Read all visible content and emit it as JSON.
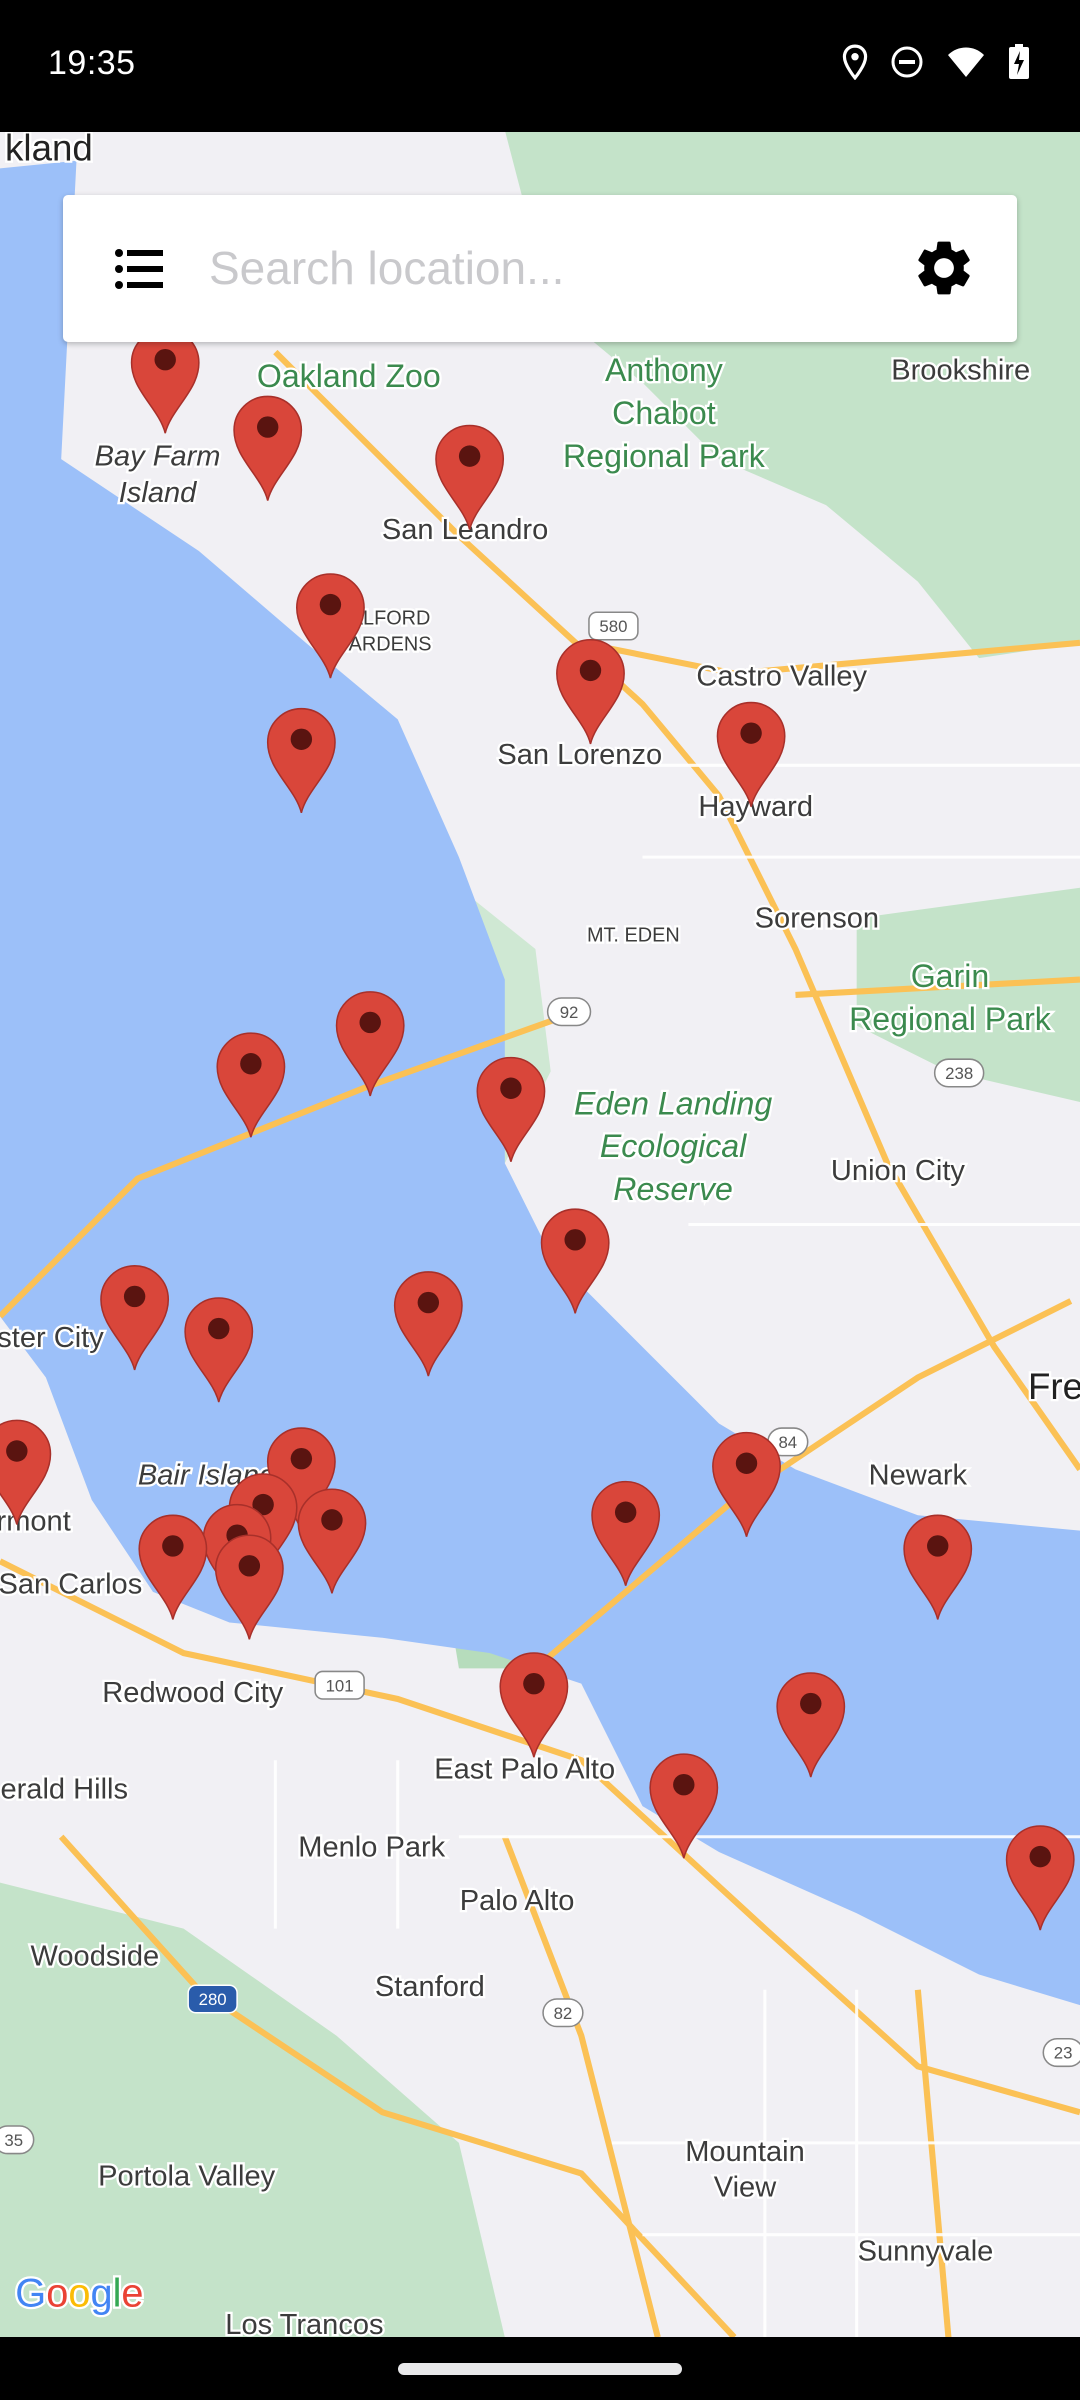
{
  "status_bar": {
    "time": "19:35",
    "icons": [
      "location-icon",
      "do-not-disturb-icon",
      "wifi-icon",
      "battery-charging-icon"
    ]
  },
  "search": {
    "placeholder": "Search location...",
    "value": "",
    "menu_icon": "list-icon",
    "settings_icon": "gear-icon"
  },
  "map": {
    "colors": {
      "water": "#9cc0f9",
      "land": "#f1f0f4",
      "park": "#c4e3c9",
      "road": "#fbc155",
      "marker": "#d9463a"
    },
    "labels": {
      "oakland": "kland",
      "oakland_zoo": "Oakland Zoo",
      "chabot_1": "Anthony",
      "chabot_2": "Chabot",
      "chabot_3": "Regional Park",
      "brookshire": "Brookshire",
      "bay_farm_1": "Bay Farm",
      "bay_farm_2": "Island",
      "san_leandro": "San Leandro",
      "alford_1": "ALFORD",
      "alford_2": "ARDENS",
      "castro_valley": "Castro Valley",
      "san_lorenzo": "San Lorenzo",
      "hayward": "Hayward",
      "sorenson": "Sorenson",
      "mt_eden": "MT. EDEN",
      "garin_1": "Garin",
      "garin_2": "Regional Park",
      "eden_1": "Eden Landing",
      "eden_2": "Ecological",
      "eden_3": "Reserve",
      "union_city": "Union City",
      "foster_city": "ster City",
      "fremont": "Fre",
      "newark": "Newark",
      "bair_island": "Bair Island",
      "belmont": "rmont",
      "san_carlos": "San Carlos",
      "redwood_city": "Redwood City",
      "east_palo_alto": "East Palo Alto",
      "emerald_hills": "erald Hills",
      "menlo_park": "Menlo Park",
      "palo_alto": "Palo Alto",
      "woodside": "Woodside",
      "stanford": "Stanford",
      "portola_valley": "Portola Valley",
      "mountain_view_1": "Mountain",
      "mountain_view_2": "View",
      "sunnyvale": "Sunnyvale",
      "los_trancos": "Los Trancos"
    },
    "highways": {
      "h580": "580",
      "h92": "92",
      "h238": "238",
      "h84": "84",
      "h101": "101",
      "h280": "280",
      "h82": "82",
      "h35": "35",
      "h23": "23"
    },
    "attribution": "Google"
  }
}
